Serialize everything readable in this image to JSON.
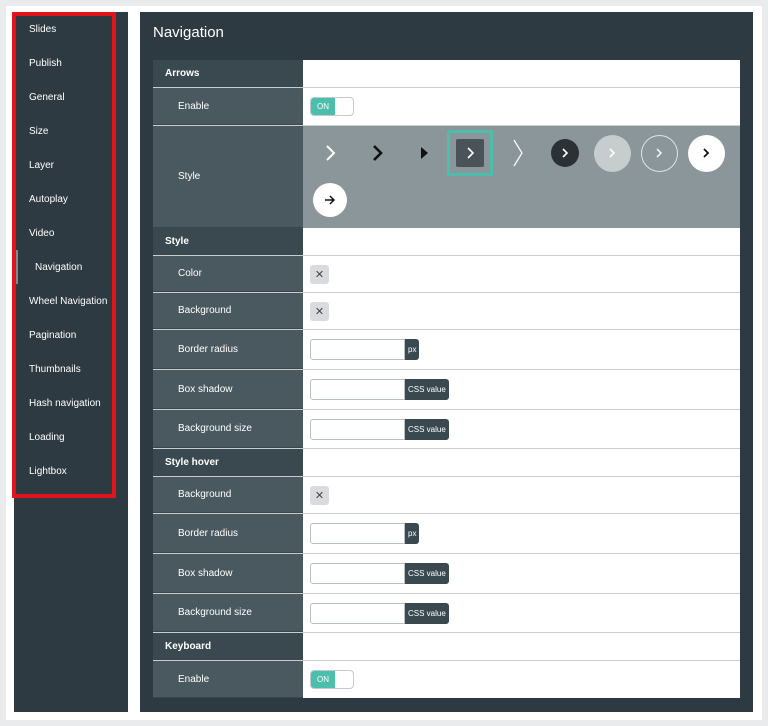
{
  "sidebar": {
    "items": [
      {
        "label": "Slides"
      },
      {
        "label": "Publish"
      },
      {
        "label": "General"
      },
      {
        "label": "Size"
      },
      {
        "label": "Layer"
      },
      {
        "label": "Autoplay"
      },
      {
        "label": "Video"
      },
      {
        "label": "Navigation"
      },
      {
        "label": "Wheel Navigation"
      },
      {
        "label": "Pagination"
      },
      {
        "label": "Thumbnails"
      },
      {
        "label": "Hash navigation"
      },
      {
        "label": "Loading"
      },
      {
        "label": "Lightbox"
      }
    ],
    "active": "Navigation",
    "highlight_color": "#e0141b"
  },
  "main": {
    "title": "Navigation",
    "accent": "#4cbfac"
  },
  "arrows": {
    "section": "Arrows",
    "enable_label": "Enable",
    "enable_value": "ON",
    "style_label": "Style",
    "style_options": [
      "chevron-thin-icon",
      "chevron-bold-icon",
      "triangle-icon",
      "chevron-square-icon",
      "chevron-line-icon",
      "chevron-dark-circle-icon",
      "chevron-light-circle-icon",
      "chevron-outline-circle-icon",
      "chevron-white-circle-icon",
      "arrow-white-circle-icon"
    ],
    "selected_style": "chevron-square-icon"
  },
  "style": {
    "section": "Style",
    "color_label": "Color",
    "background_label": "Background",
    "border_radius_label": "Border radius",
    "border_radius_unit": "px",
    "box_shadow_label": "Box shadow",
    "box_shadow_unit": "CSS value",
    "background_size_label": "Background size",
    "background_size_unit": "CSS value",
    "clear_glyph": "✕"
  },
  "style_hover": {
    "section": "Style hover",
    "background_label": "Background",
    "border_radius_label": "Border radius",
    "border_radius_unit": "px",
    "box_shadow_label": "Box shadow",
    "box_shadow_unit": "CSS value",
    "background_size_label": "Background size",
    "background_size_unit": "CSS value"
  },
  "keyboard": {
    "section": "Keyboard",
    "enable_label": "Enable",
    "enable_value": "ON"
  }
}
